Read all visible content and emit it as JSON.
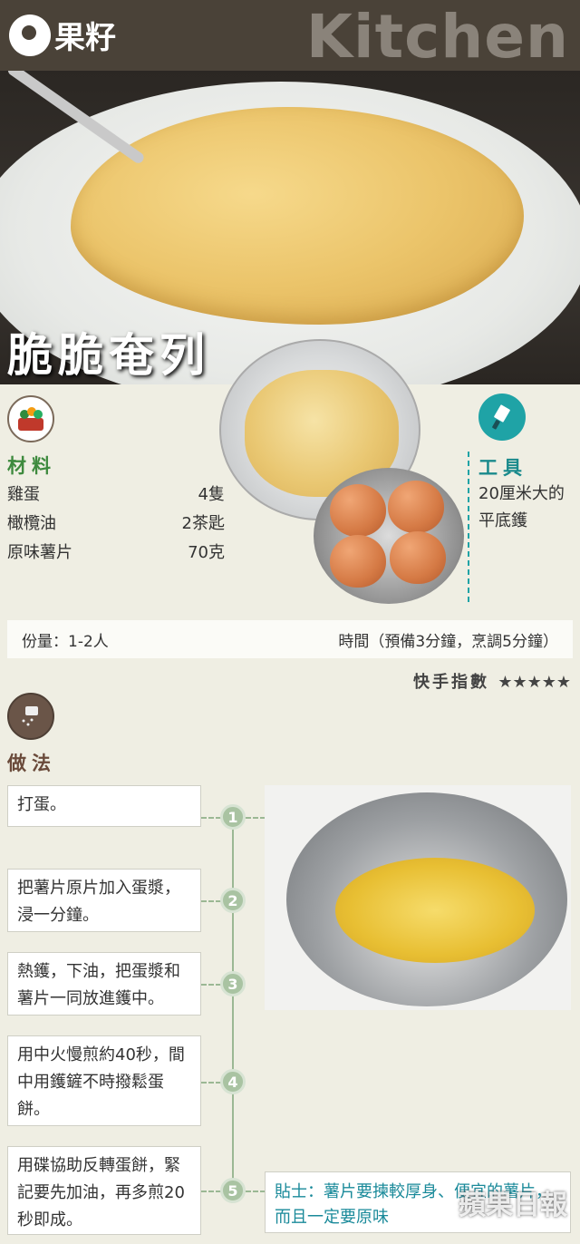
{
  "header": {
    "logo_text": "果籽",
    "section": "Kitchen"
  },
  "dish": {
    "title": "脆脆奄列"
  },
  "materials": {
    "label": "材料",
    "items": [
      {
        "name": "雞蛋",
        "qty": "4隻"
      },
      {
        "name": "橄欖油",
        "qty": "2茶匙"
      },
      {
        "name": "原味薯片",
        "qty": "70克"
      }
    ]
  },
  "tools": {
    "label": "工具",
    "text": "20厘米大的平底鑊"
  },
  "info": {
    "serving": "份量：1-2人",
    "time": "時間（預備3分鐘，烹調5分鐘）"
  },
  "speed": {
    "label": "快手指數",
    "stars": "★★★★★"
  },
  "method": {
    "label": "做法",
    "steps": [
      {
        "num": "1",
        "text": "打蛋。"
      },
      {
        "num": "2",
        "text": "把薯片原片加入蛋漿，浸一分鐘。"
      },
      {
        "num": "3",
        "text": "熱鑊，下油，把蛋漿和薯片一同放進鑊中。"
      },
      {
        "num": "4",
        "text": "用中火慢煎約40秒，間中用鑊鏟不時撥鬆蛋餅。"
      },
      {
        "num": "5",
        "text": "用碟協助反轉蛋餅，緊記要先加油，再多煎20秒即成。"
      }
    ]
  },
  "tip": {
    "text": "貼士：薯片要揀較厚身、便宜的薯片，而且一定要原味"
  },
  "watermark": "蘋果日報",
  "colors": {
    "green": "#3e8a3e",
    "teal": "#1fa3a6",
    "brown": "#6a4a3a",
    "step_circle": "#a9c3a2"
  }
}
